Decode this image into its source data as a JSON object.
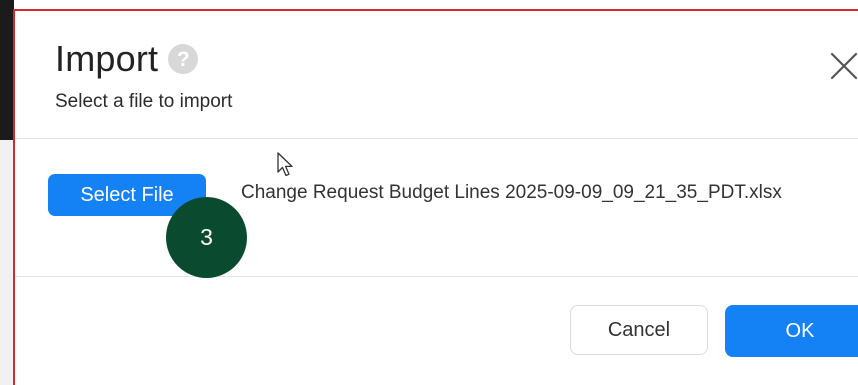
{
  "dialog": {
    "title": "Import",
    "help_glyph": "?",
    "subtitle": "Select a file to import",
    "close_icon": "close-icon"
  },
  "body": {
    "select_file_label": "Select File",
    "file_name": "Change Request Budget Lines 2025-09-09_09_21_35_PDT.xlsx"
  },
  "annotation": {
    "step_number": "3",
    "badge_color": "#0a4b2f"
  },
  "footer": {
    "cancel_label": "Cancel",
    "ok_label": "OK"
  },
  "colors": {
    "accent": "#1481f5",
    "frame_highlight": "#d42a2a"
  }
}
